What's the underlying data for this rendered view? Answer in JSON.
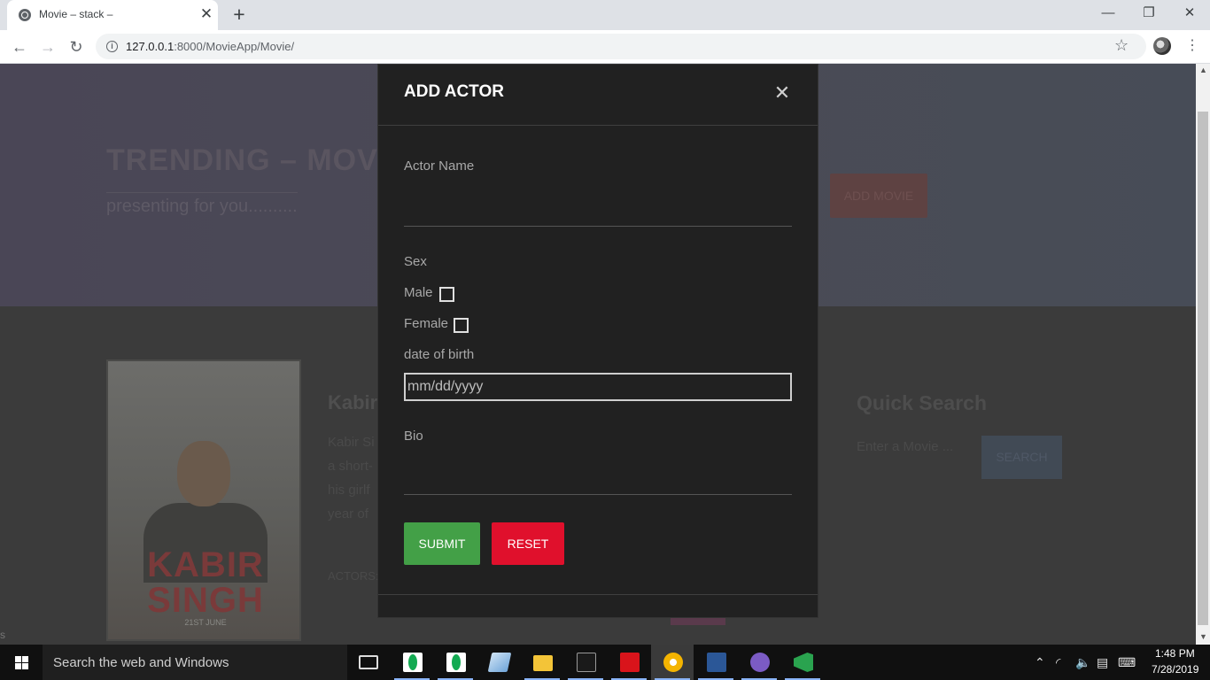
{
  "browser": {
    "tab_title": "Movie – stack –",
    "new_tab_symbol": "+",
    "tab_close_symbol": "✕",
    "url_host": "127.0.0.1",
    "url_path": ":8000/MovieApp/Movie/",
    "window_controls": [
      "—",
      "❐",
      "✕"
    ],
    "icons": [
      "back-icon",
      "forward-icon",
      "reload-icon",
      "info-icon",
      "bookmark-star-icon",
      "profile-icon",
      "menu-icon"
    ]
  },
  "page": {
    "hero_title": "TRENDING – MOVI",
    "hero_subtitle": "presenting for you..........",
    "add_movie_label": "ADD MOVIE",
    "movie_name": "Kabir",
    "movie_desc_lines": [
      "Kabir Si",
      "a short-",
      "his girlf",
      "year of"
    ],
    "actors_label": "ACTORS:",
    "poster_title_line1": "KABIR",
    "poster_title_line2": "SINGH",
    "poster_date": "21ST JUNE",
    "quick_search_title": "Quick Search",
    "quick_search_placeholder": "Enter a Movie ...",
    "quick_search_button": "SEARCH",
    "stray_text": "s"
  },
  "modal": {
    "title": "ADD ACTOR",
    "close_symbol": "✕",
    "actor_name_label": "Actor Name",
    "actor_name_value": "",
    "sex_label": "Sex",
    "male_label": "Male",
    "female_label": "Female",
    "male_checked": false,
    "female_checked": false,
    "dob_label": "date of birth",
    "dob_placeholder": "mm/dd/yyyy",
    "bio_label": "Bio",
    "bio_value": "",
    "submit_label": "SUBMIT",
    "reset_label": "RESET",
    "colors": {
      "submit": "#43a047",
      "reset": "#e0102c",
      "background": "#212121"
    }
  },
  "taskbar": {
    "search_text": "Search the web and Windows",
    "apps": [
      "task-view-icon",
      "mongodb-compass-icon",
      "mongodb-compass-icon",
      "notepad-icon",
      "file-explorer-icon",
      "terminal-icon",
      "acrobat-icon",
      "chrome-icon",
      "word-icon",
      "github-desktop-icon",
      "visual-studio-code-icon"
    ],
    "time": "1:48 PM",
    "date": "7/28/2019"
  }
}
